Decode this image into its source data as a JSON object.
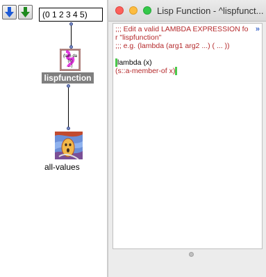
{
  "patch": {
    "down_arrow_blue": "down-arrow-blue",
    "down_arrow_green": "down-arrow-green",
    "list_value": "(0 1 2 3 4 5)",
    "lisp_box_label": "lispfunction",
    "all_values_label": "all-values"
  },
  "window": {
    "title": "Lisp Function - ^lispfunct...",
    "more_indicator": "»",
    "comment_lines": [
      ";;; Edit a valid LAMBDA EXPRESSION fo",
      "r \"lispfunction\"",
      ";;; e.g. (lambda (arg1 arg2 ...) ( ... ))"
    ],
    "code_line1": "lambda (x)",
    "code_line2": "(s::a-member-of x)"
  },
  "colors": {
    "comment": "#b4282a",
    "paren_highlight": "#4cc94c",
    "label_bg": "#7f7f7f",
    "inlet": "#7a8ec8"
  }
}
